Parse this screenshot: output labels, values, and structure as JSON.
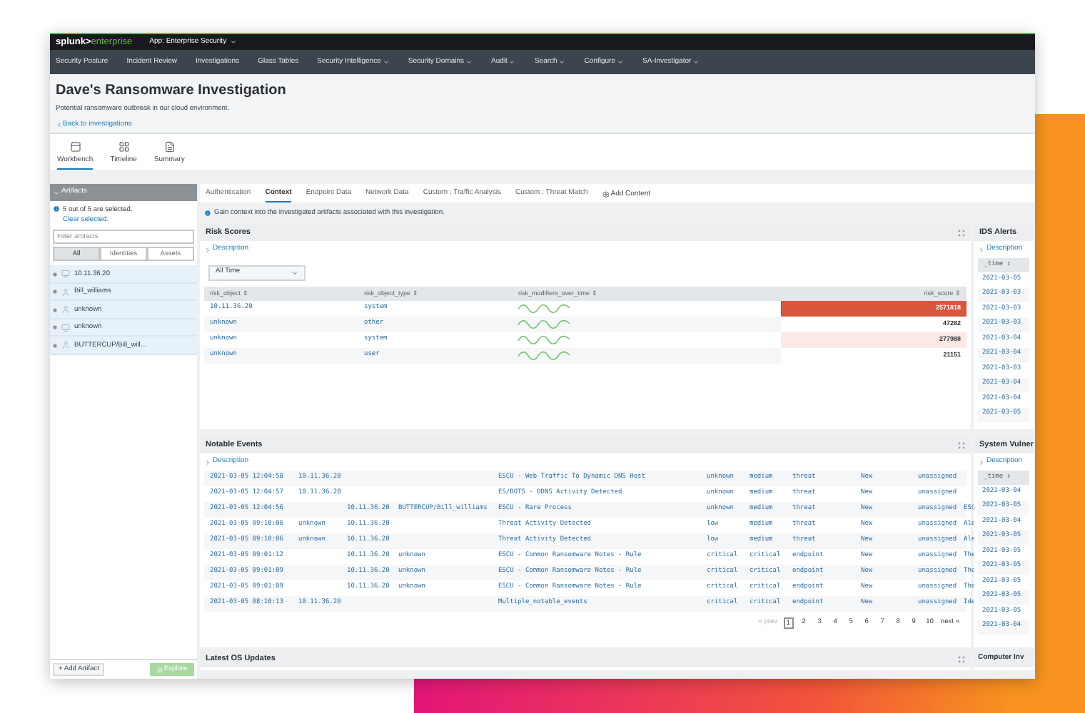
{
  "top_bar": {
    "logo": {
      "brand": "splunk>",
      "product": "enterprise"
    },
    "app_menu": "App: Enterprise Security"
  },
  "nav": [
    {
      "label": "Security Posture",
      "menu": false
    },
    {
      "label": "Incident Review",
      "menu": false
    },
    {
      "label": "Investigations",
      "menu": false
    },
    {
      "label": "Glass Tables",
      "menu": false
    },
    {
      "label": "Security Intelligence",
      "menu": true
    },
    {
      "label": "Security Domains",
      "menu": true
    },
    {
      "label": "Audit",
      "menu": true
    },
    {
      "label": "Search",
      "menu": true
    },
    {
      "label": "Configure",
      "menu": true
    },
    {
      "label": "SA-Investigator",
      "menu": true
    }
  ],
  "header": {
    "title": "Dave's Ransomware Investigation",
    "subtitle": "Potential ransomware outbreak in our cloud environment.",
    "back_link": "Back to investigations"
  },
  "view_tabs": [
    {
      "label": "Workbench",
      "kind": "workbench",
      "selected": true
    },
    {
      "label": "Timeline",
      "kind": "timeline",
      "selected": false
    },
    {
      "label": "Summary",
      "kind": "summary",
      "selected": false
    }
  ],
  "artifacts": {
    "title": "Artifacts",
    "selection_note": "5 out of 5 are selected.",
    "clear_link": "Clear selected.",
    "filter": {
      "placeholder": "Filter artifacts"
    },
    "filters": [
      {
        "label": "All",
        "selected": true
      },
      {
        "label": "Identities",
        "selected": false
      },
      {
        "label": "Assets",
        "selected": false
      }
    ],
    "items": [
      {
        "kind": "asset",
        "label": "10.11.36.20",
        "selected": true
      },
      {
        "kind": "identity",
        "label": "Bill_williams",
        "selected": true
      },
      {
        "kind": "identity",
        "label": "unknown",
        "selected": true
      },
      {
        "kind": "asset",
        "label": "unknown",
        "selected": true
      },
      {
        "kind": "identity",
        "label": "BUTTERCUP/Bill_will...",
        "selected": true
      }
    ],
    "add_button": "+ Add Artifact",
    "explore_button": {
      "label": "Explore",
      "disabled": true
    }
  },
  "content_tabs": [
    {
      "label": "Authentication",
      "selected": false
    },
    {
      "label": "Context",
      "selected": true
    },
    {
      "label": "Endpoint Data",
      "selected": false
    },
    {
      "label": "Network Data",
      "selected": false
    },
    {
      "label": "Custom : Traffic Analysis",
      "selected": false
    },
    {
      "label": "Custom : Threat Match",
      "selected": false
    }
  ],
  "add_content": "Add Content",
  "info": "Gain context into the investigated artifacts associated with this investigation.",
  "risk_scores": {
    "title": "Risk Scores",
    "description": "Description",
    "time_range": "All Time",
    "columns": [
      "risk_object ⇕",
      "risk_object_type ⇕",
      "risk_modifiers_over_time ⇕",
      "risk_score ⇕"
    ],
    "rows": [
      {
        "risk_object": "10.11.36.20",
        "risk_object_type": "system",
        "risk_score": "2571818",
        "color": "#d9553b"
      },
      {
        "risk_object": "unknown",
        "risk_object_type": "other",
        "risk_score": "47282",
        "color": "#ffffff"
      },
      {
        "risk_object": "unknown",
        "risk_object_type": "system",
        "risk_score": "277988",
        "color": "#fbe9e6"
      },
      {
        "risk_object": "unknown",
        "risk_object_type": "user",
        "risk_score": "21151",
        "color": "#ffffff"
      }
    ]
  },
  "ids_alerts": {
    "title": "IDS Alerts",
    "description": "Description",
    "column": "_time ⇕",
    "rows": [
      "2021-03-05",
      "2021-03-03",
      "2021-03-03",
      "2021-03-03",
      "2021-03-04",
      "2021-03-04",
      "2021-03-03",
      "2021-03-04",
      "2021-03-04",
      "2021-03-05"
    ]
  },
  "notable_events": {
    "title": "Notable Events",
    "description": "Description",
    "rows": [
      {
        "time": "2021-03-05 12:04:58",
        "column_2": "10.11.36.20",
        "title": "ESCU - Web Traffic To Dynamic DNS Host",
        "column_6": "unknown",
        "column_7": "medium",
        "column_8": "threat",
        "column_9": "New",
        "column_10": "unassigned"
      },
      {
        "time": "2021-03-05 12:04:57",
        "column_2": "10.11.36.20",
        "title": "ES/BOTS - DDNS Activity Detected",
        "column_6": "unknown",
        "column_7": "medium",
        "column_8": "threat",
        "column_9": "New",
        "column_10": "unassigned"
      },
      {
        "time": "2021-03-05 12:04:56",
        "column_3": "10.11.36.20",
        "column_4": "BUTTERCUP/Bill_williams",
        "title": "ESCU - Rare Process",
        "column_6": "unknown",
        "column_7": "medium",
        "column_8": "threat",
        "column_9": "New",
        "column_10": "unassigned",
        "column_11": "ESC"
      },
      {
        "time": "2021-03-05 09:10:06",
        "column_2": "unknown",
        "column_3": "10.11.36.20",
        "title": "Threat Activity Detected",
        "column_6": "low",
        "column_7": "medium",
        "column_8": "threat",
        "column_9": "New",
        "column_10": "unassigned",
        "column_11": "Ale"
      },
      {
        "time": "2021-03-05 09:10:06",
        "column_2": "unknown",
        "column_3": "10.11.36.20",
        "title": "Threat Activity Detected",
        "column_6": "low",
        "column_7": "medium",
        "column_8": "threat",
        "column_9": "New",
        "column_10": "unassigned",
        "column_11": "Ale"
      },
      {
        "time": "2021-03-05 09:01:12",
        "column_3": "10.11.36.20",
        "column_4": "unknown",
        "title": "ESCU - Common Ransomware Notes - Rule",
        "column_6": "critical",
        "column_7": "critical",
        "column_8": "endpoint",
        "column_9": "New",
        "column_10": "unassigned",
        "column_11": "The"
      },
      {
        "time": "2021-03-05 09:01:09",
        "column_3": "10.11.36.20",
        "column_4": "unknown",
        "title": "ESCU - Common Ransomware Notes - Rule",
        "column_6": "critical",
        "column_7": "critical",
        "column_8": "endpoint",
        "column_9": "New",
        "column_10": "unassigned",
        "column_11": "The"
      },
      {
        "time": "2021-03-05 09:01:09",
        "column_3": "10.11.36.20",
        "column_4": "unknown",
        "title": "ESCU - Common Ransomware Notes - Rule",
        "column_6": "critical",
        "column_7": "critical",
        "column_8": "endpoint",
        "column_9": "New",
        "column_10": "unassigned",
        "column_11": "The"
      },
      {
        "time": "2021-03-05 08:10:13",
        "column_2": "10.11.36.20",
        "title": "Multiple_notable_events",
        "column_6": "critical",
        "column_7": "critical",
        "column_8": "endpoint",
        "column_9": "New",
        "column_10": "unassigned",
        "column_11": "Ide"
      }
    ],
    "pagination": {
      "prev": "« prev",
      "pages": [
        {
          "label": "1",
          "selected": true
        },
        {
          "label": "2",
          "selected": false
        },
        {
          "label": "3",
          "selected": false
        },
        {
          "label": "4",
          "selected": false
        },
        {
          "label": "5",
          "selected": false
        },
        {
          "label": "6",
          "selected": false
        },
        {
          "label": "7",
          "selected": false
        },
        {
          "label": "8",
          "selected": false
        },
        {
          "label": "9",
          "selected": false
        },
        {
          "label": "10",
          "selected": false
        }
      ],
      "next": "next »"
    }
  },
  "system_vulnerabilities": {
    "title": "System Vulner",
    "description": "Description",
    "column": "_time ⇕",
    "rows": [
      "2021-03-04",
      "2021-03-05",
      "2021-03-04",
      "2021-03-05",
      "2021-03-05",
      "2021-03-05",
      "2021-03-05",
      "2021-03-05",
      "2021-03-05",
      "2021-03-04"
    ]
  },
  "latest_os_updates": {
    "title": "Latest OS Updates"
  },
  "computer_inventory": {
    "title": "Computer Inv"
  }
}
